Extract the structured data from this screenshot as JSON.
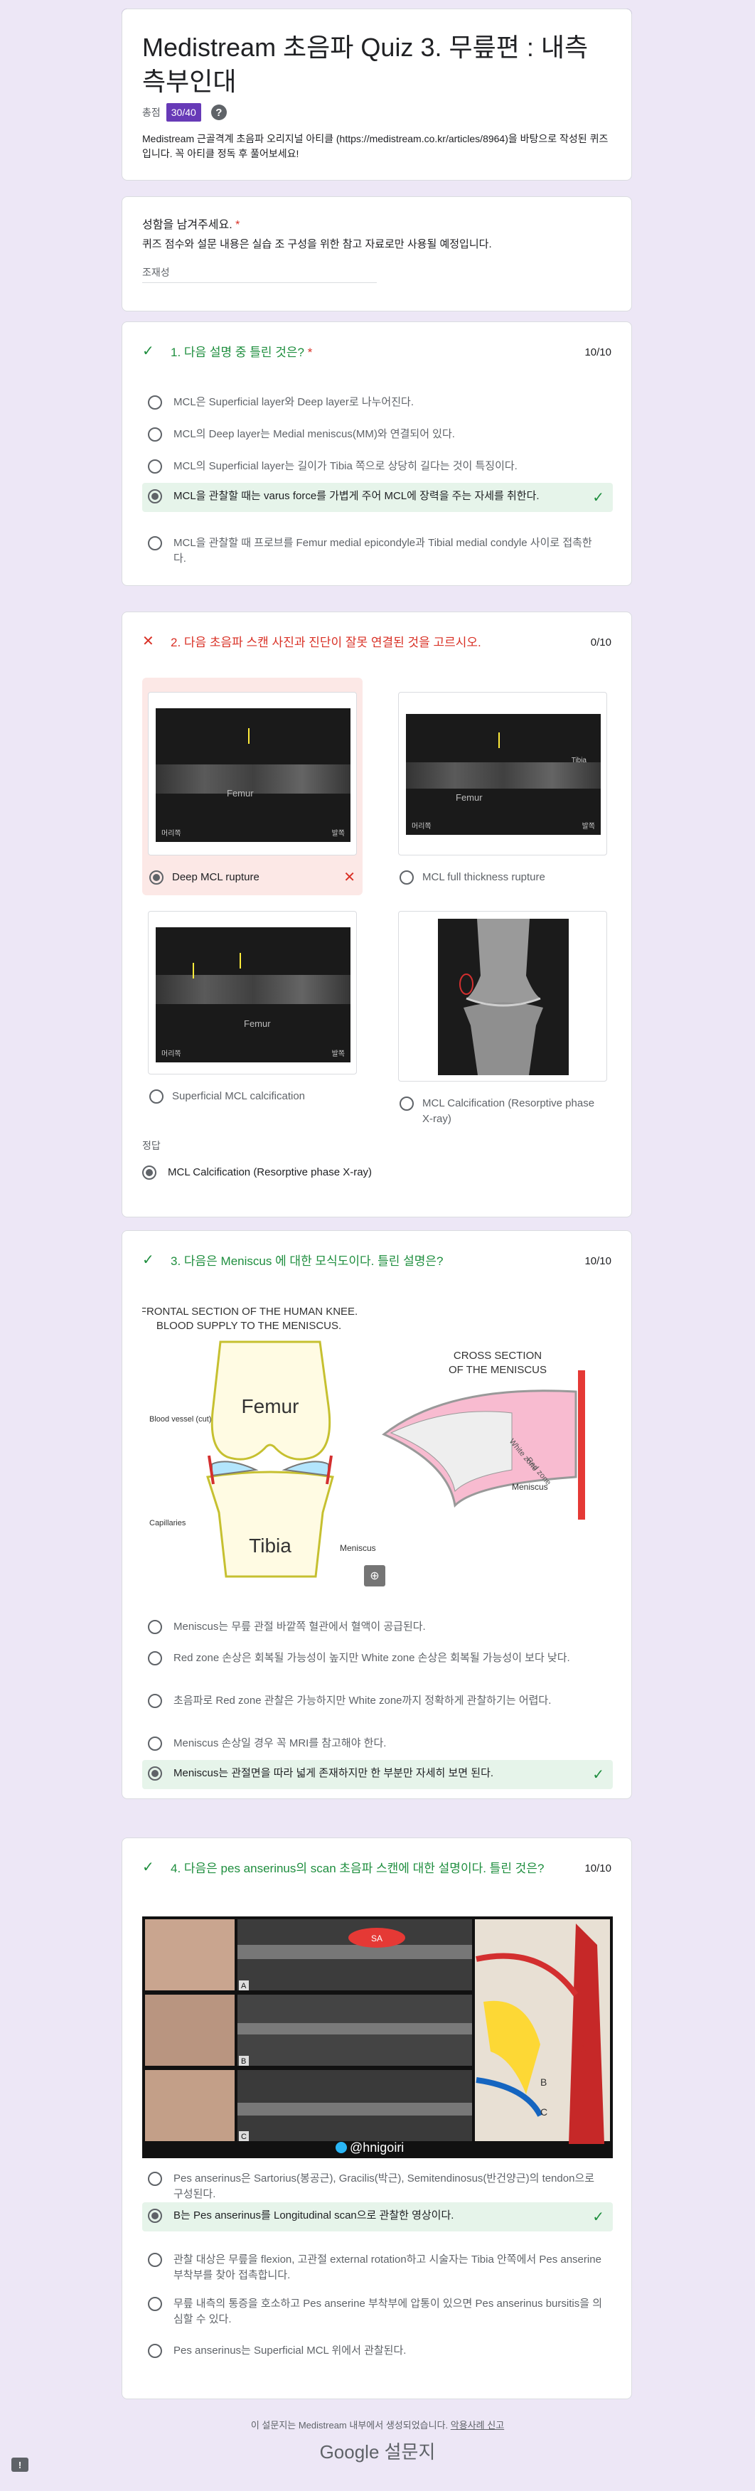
{
  "header": {
    "title": "Medistream 초음파 Quiz 3. 무릎편 : 내측측부인대",
    "score_label": "총점",
    "score_value": "30/40",
    "description": "Medistream 근골격계 초음파 오리지널 아티클 (https://medistream.co.kr/articles/8964)을 바탕으로 작성된 퀴즈입니다. 꼭 아티클 정독 후 풀어보세요!"
  },
  "name_question": {
    "label": "성함을 남겨주세요.",
    "required": "*",
    "sub": "퀴즈 점수와 설문 내용은 실습 조 구성을 위한 참고 자료로만 사용될 예정입니다.",
    "value": "조재성"
  },
  "q1": {
    "mark": "✓",
    "text": "1. 다음 설명 중 틀린 것은?",
    "required": "*",
    "score": "10/10",
    "options": [
      "MCL은 Superficial layer와 Deep layer로 나누어진다.",
      "MCL의 Deep layer는 Medial meniscus(MM)와 연결되어 있다.",
      "MCL의 Superficial layer는 길이가 Tibia 쪽으로 상당히 길다는 것이 특징이다.",
      "MCL을 관찰할 때는 varus force를 가볍게 주어 MCL에 장력을 주는 자세를 취한다.",
      "MCL을 관찰할 때 프로브를 Femur medial epicondyle과 Tibial medial condyle 사이로 접촉한다."
    ]
  },
  "q2": {
    "mark": "✕",
    "text": "2. 다음 초음파 스캔 사진과 진단이 잘못 연결된 것을 고르시오.",
    "score": "0/10",
    "options": [
      "Deep MCL rupture",
      "MCL full thickness rupture",
      "Superficial MCL calcification",
      "MCL Calcification (Resorptive phase X-ray)"
    ],
    "us_labels": {
      "femur": "Femur",
      "tibia": "Tibia",
      "left": "머리쪽",
      "right": "발쪽"
    },
    "answer_label": "정답",
    "answer": "MCL Calcification (Resorptive phase X-ray)"
  },
  "q3": {
    "mark": "✓",
    "text": "3. 다음은  Meniscus 에 대한 모식도이다. 틀린 설명은?",
    "score": "10/10",
    "figure": {
      "title1": "FRONTAL SECTION OF THE HUMAN KNEE.",
      "title2": "BLOOD SUPPLY TO THE MENISCUS.",
      "cross1": "CROSS SECTION",
      "cross2": "OF THE MENISCUS",
      "femur": "Femur",
      "tibia": "Tibia",
      "blood_vessel": "Blood vessel (cut)",
      "capillaries": "Capillaries",
      "meniscus": "Meniscus",
      "meniscus2": "Meniscus",
      "red_zone": "Red zone",
      "white_zone": "White zone"
    },
    "options": [
      "Meniscus는 무릎 관절 바깥쪽 혈관에서 혈액이 공급된다.",
      "Red zone 손상은 회복될 가능성이 높지만 White zone 손상은 회복될 가능성이 보다 낮다.",
      "초음파로 Red zone 관찰은 가능하지만 White zone까지 정확하게 관찰하기는 어렵다.",
      "Meniscus 손상일 경우 꼭 MRI를 참고해야 한다.",
      "Meniscus는 관절면을 따라 넓게 존재하지만 한 부분만 자세히 보면 된다."
    ]
  },
  "q4": {
    "mark": "✓",
    "text": "4. 다음은 pes anserinus의 scan 초음파 스캔에 대한 설명이다. 틀린 것은?",
    "score": "10/10",
    "figure": {
      "watermark": "@hnigoiri",
      "a": "A",
      "b": "B",
      "c": "C",
      "sa": "SA"
    },
    "options": [
      "Pes anserinus은 Sartorius(봉공근), Gracilis(박근), Semitendinosus(반건양근)의 tendon으로 구성된다.",
      "B는 Pes anserinus를 Longitudinal scan으로 관찰한 영상이다.",
      "관찰 대상은 무릎을 flexion, 고관절 external rotation하고 시술자는 Tibia 안쪽에서 Pes anserine 부착부를 찾아 접촉합니다.",
      "무릎 내측의 통증을 호소하고 Pes anserine 부착부에 압통이 있으면 Pes anserinus bursitis을 의심할 수 있다.",
      "Pes anserinus는 Superficial MCL 위에서 관찰된다."
    ]
  },
  "footer": {
    "note": "이 설문지는 Medistream 내부에서 생성되었습니다.",
    "report_link": "악용사례 신고",
    "brand": "Google 설문지",
    "report_icon": "!"
  },
  "colors": {
    "accent": "#673ab7",
    "correct": "#1e8e3e",
    "wrong": "#d93025",
    "background": "#ede7f6"
  }
}
